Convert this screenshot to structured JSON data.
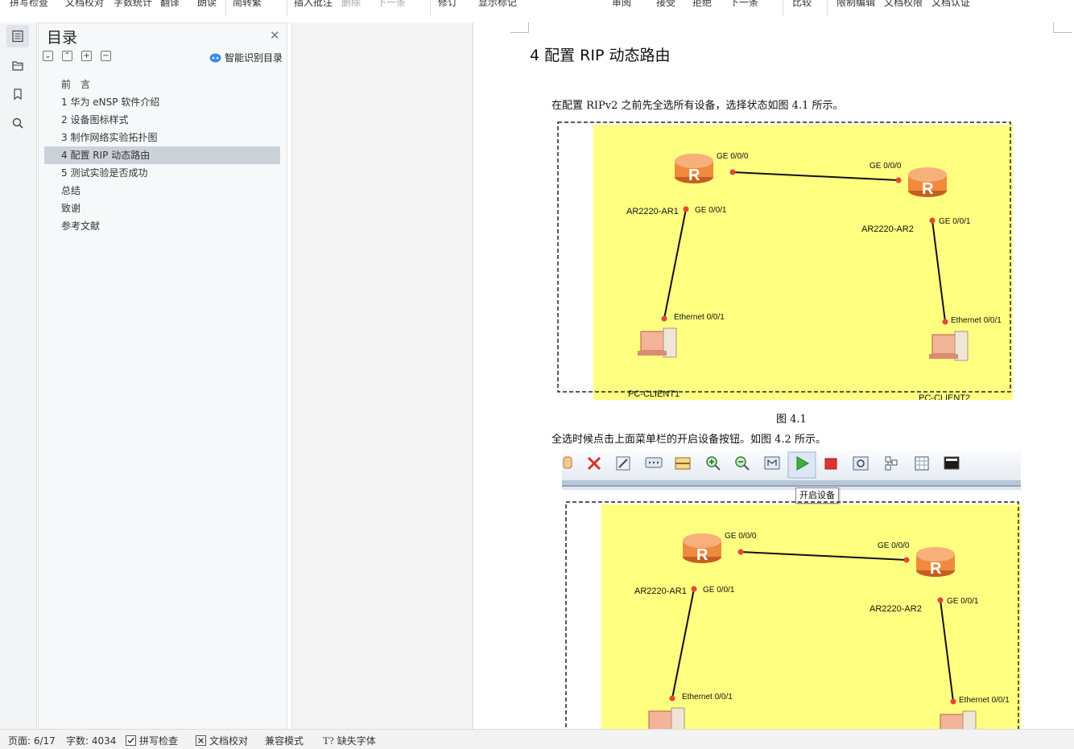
{
  "toolbar": {
    "items": [
      "拼写检查",
      "文档校对",
      "字数统计",
      "翻译",
      "朗读",
      "简转繁",
      "插入批注",
      "删除",
      "下一条",
      "修订",
      "显示标记",
      "审阅",
      "接受",
      "拒绝",
      "下一条",
      "比较",
      "限制编辑",
      "文档权限",
      "文档认证"
    ]
  },
  "toc": {
    "title": "目录",
    "smart_label": "智能识别目录",
    "items": [
      "前　言",
      "1 华为 eNSP 软件介绍",
      "2 设备图标样式",
      "3 制作网络实验拓扑图",
      "4 配置 RIP 动态路由",
      "5 测试实验是否成功",
      "总结",
      "致谢",
      "参考文献"
    ],
    "selected_index": 4
  },
  "doc": {
    "heading": "4 配置 RIP 动态路由",
    "para1": "在配置 RIPv2 之前先全选所有设备，选择状态如图 4.1 所示。",
    "caption1": "图 4.1",
    "para2": "全选时候点击上面菜单栏的开启设备按钮。如图 4.2 所示。",
    "tooltip": "开启设备",
    "topology": {
      "ar1": "AR2220-AR1",
      "ar2": "AR2220-AR2",
      "pc1": "PC-CLIENT1",
      "pc2": "PC-CLIENT2",
      "ar1_ge000": "GE 0/0/0",
      "ar1_ge001": "GE 0/0/1",
      "ar2_ge000": "GE 0/0/0",
      "ar2_ge001": "GE 0/0/1",
      "pc1_eth": "Ethernet 0/0/1",
      "pc2_eth": "Ethernet 0/0/1"
    },
    "colors": {
      "canvas": "#ffff80",
      "link": "#111111",
      "port_dot": "#e8443a",
      "router": "#f08a3c"
    }
  },
  "status": {
    "page": "页面: 6/17",
    "words": "字数: 4034",
    "spell": "拼写检查",
    "proof": "文档校对",
    "compat": "兼容模式",
    "missing_font": "缺失字体"
  }
}
